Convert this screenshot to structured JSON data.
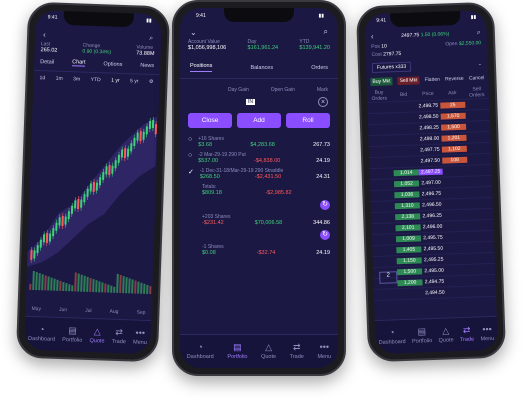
{
  "left": {
    "time": "9:41",
    "stats": [
      {
        "label": "Last",
        "value": "265.02"
      },
      {
        "label": "Change",
        "value": "0.90 (0.34%)"
      },
      {
        "label": "Volume",
        "value": "73.88M"
      }
    ],
    "tabs": [
      "Detail",
      "Chart",
      "Options",
      "News"
    ],
    "ranges": [
      "1d",
      "1m",
      "3m",
      "YTD",
      "1 yr",
      "5 yr"
    ],
    "months": [
      "May",
      "Jun",
      "Jul",
      "Aug",
      "Sep"
    ],
    "nav": [
      "Dashboard",
      "Portfolio",
      "Quote",
      "Trade",
      "Menu"
    ]
  },
  "center": {
    "time": "9:41",
    "account_value_label": "Account Value",
    "account_value": "$1,056,998,106",
    "day_label": "Day",
    "day_value": "$161,961.24",
    "ytd_label": "YTD",
    "ytd_value": "$139,941.20",
    "tabs": [
      "Positions",
      "Balances",
      "Orders"
    ],
    "col_day_gain": "Day Gain",
    "col_open_gain": "Open Gain",
    "col_mark": "Mark",
    "buttons": {
      "close": "Close",
      "add": "Add",
      "roll": "Roll"
    },
    "positions": [
      {
        "title": "+16 Shares",
        "day": "$3.68",
        "open": "$4,283.68",
        "mark": "267.73"
      },
      {
        "title": "-2 Mar-29-19 290 Put",
        "day": "$537.00",
        "open": "-$4,838.00",
        "mark": "24.19"
      },
      {
        "title": "-1 Dec-31-18/Mar-29-19 290 Straddle",
        "day": "$268.50",
        "open": "-$2,431.50",
        "mark": "24.31"
      }
    ],
    "totals_label": "Totals:",
    "totals_day": "$809.18",
    "totals_open": "-$2,985.82",
    "pos2_title": "+203 Shares",
    "pos2_day": "-$231.42",
    "pos2_open": "$70,006.58",
    "pos2_mark": "344.86",
    "pos3_title": "-1 Shares",
    "pos3_day": "$0.08",
    "pos3_open": "-$32.74",
    "pos3_mark": "24.19",
    "nav": [
      "Dashboard",
      "Portfolio",
      "Quote",
      "Trade",
      "Menu"
    ]
  },
  "right": {
    "time": "9:41",
    "price": "2497.75",
    "change": "1.50 (0.06%)",
    "pos": "10",
    "open": "$2,550.00",
    "cost": "2797.75",
    "account": "Futures x333",
    "buttons": [
      "Buy Mkt",
      "Sell Mkt",
      "Flatten",
      "Reverse",
      "Cancel"
    ],
    "headers": [
      "Buy Orders",
      "Bid",
      "Price",
      "Ask",
      "Sell Orders"
    ],
    "ladder": [
      {
        "bid": "",
        "price": "2,498.75",
        "ask": "25"
      },
      {
        "bid": "",
        "price": "2,498.50",
        "ask": "1,570"
      },
      {
        "bid": "",
        "price": "2,498.25",
        "ask": "1,500"
      },
      {
        "bid": "",
        "price": "2,498.00",
        "ask": "1,201"
      },
      {
        "bid": "",
        "price": "2,497.75",
        "ask": "1,102"
      },
      {
        "bid": "",
        "price": "2,497.50",
        "ask": "108"
      },
      {
        "bid": "1,014",
        "price": "2,497.25",
        "ask": ""
      },
      {
        "bid": "1,052",
        "price": "2,497.00",
        "ask": ""
      },
      {
        "bid": "1,036",
        "price": "2,496.75",
        "ask": ""
      },
      {
        "bid": "1,310",
        "price": "2,496.50",
        "ask": ""
      },
      {
        "bid": "2,138",
        "price": "2,496.25",
        "ask": ""
      },
      {
        "bid": "2,101",
        "price": "2,496.00",
        "ask": ""
      },
      {
        "bid": "1,009",
        "price": "2,495.75",
        "ask": ""
      },
      {
        "bid": "1,405",
        "price": "2,495.50",
        "ask": ""
      },
      {
        "bid": "1,150",
        "price": "2,495.25",
        "ask": ""
      },
      {
        "bid": "1,500",
        "price": "2,495.00",
        "ask": ""
      },
      {
        "bid": "1,200",
        "price": "2,494.75",
        "ask": ""
      },
      {
        "bid": "",
        "price": "2,494.50",
        "ask": ""
      }
    ],
    "working_qty": "2",
    "nav": [
      "Dashboard",
      "Portfolio",
      "Quote",
      "Trade",
      "Menu"
    ]
  }
}
